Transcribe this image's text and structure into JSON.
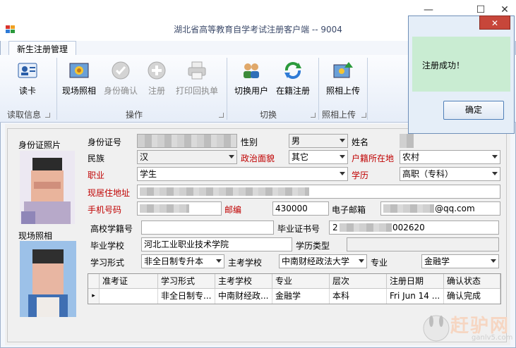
{
  "window": {
    "title": "湖北省高等教育自学考试注册客户端 -- 9004",
    "tab": "新生注册管理"
  },
  "ribbon": {
    "buttons": [
      {
        "label": "读卡",
        "icon": "id-card-icon",
        "enabled": true
      },
      {
        "label": "现场照相",
        "icon": "camera-photo-icon",
        "enabled": true
      },
      {
        "label": "身份确认",
        "icon": "check-circle-icon",
        "enabled": false
      },
      {
        "label": "注册",
        "icon": "plus-circle-icon",
        "enabled": false
      },
      {
        "label": "打印回执单",
        "icon": "printer-icon",
        "enabled": false
      },
      {
        "label": "切换用户",
        "icon": "users-icon",
        "enabled": true
      },
      {
        "label": "在籍注册",
        "icon": "refresh-icon",
        "enabled": true
      },
      {
        "label": "照相上传",
        "icon": "photo-upload-icon",
        "enabled": true
      }
    ],
    "groups": [
      "读取信息",
      "操作",
      "切换",
      "照相上传"
    ]
  },
  "form": {
    "id_photo_label": "身份证照片",
    "live_photo_label": "现场照相",
    "labels": {
      "id_number": "身份证号",
      "gender": "性别",
      "name": "姓名",
      "ethnicity": "民族",
      "political": "政治面貌",
      "household": "户籍所在地",
      "occupation": "职业",
      "education": "学历",
      "address": "现居住地址",
      "mobile": "手机号码",
      "postcode": "邮编",
      "email": "电子邮箱",
      "student_no": "高校学籍号",
      "cert_no": "毕业证书号",
      "school": "毕业学校",
      "edu_type": "学历类型",
      "study_form": "学习形式",
      "host_school": "主考学校",
      "major": "专业"
    },
    "values": {
      "gender": "男",
      "ethnicity": "汉",
      "political": "其它",
      "household": "农村",
      "occupation": "学生",
      "education": "高职（专科）",
      "postcode": "430000",
      "email_suffix": "@qq.com",
      "cert_suffix": "002620",
      "cert_prefix": "2",
      "school": "河北工业职业技术学院",
      "study_form": "非全日制专升本",
      "host_school": "中南财经政法大学",
      "major": "金融学"
    }
  },
  "grid": {
    "columns": [
      "准考证",
      "学习形式",
      "主考学校",
      "专业",
      "层次",
      "注册日期",
      "确认状态"
    ],
    "rows": [
      [
        "",
        "非全日制专...",
        "中南财经政...",
        "金融学",
        "本科",
        "Fri Jun 14 ...",
        "确认完成"
      ]
    ]
  },
  "dialog": {
    "message": "注册成功！",
    "ok_label": "确定",
    "close_label": "✕"
  },
  "watermark": {
    "text": "赶驴网",
    "url": "ganlv5.com"
  },
  "colors": {
    "required_label": "#c00000",
    "dialog_body": "#c9ecd2",
    "close_button": "#c7463a"
  }
}
